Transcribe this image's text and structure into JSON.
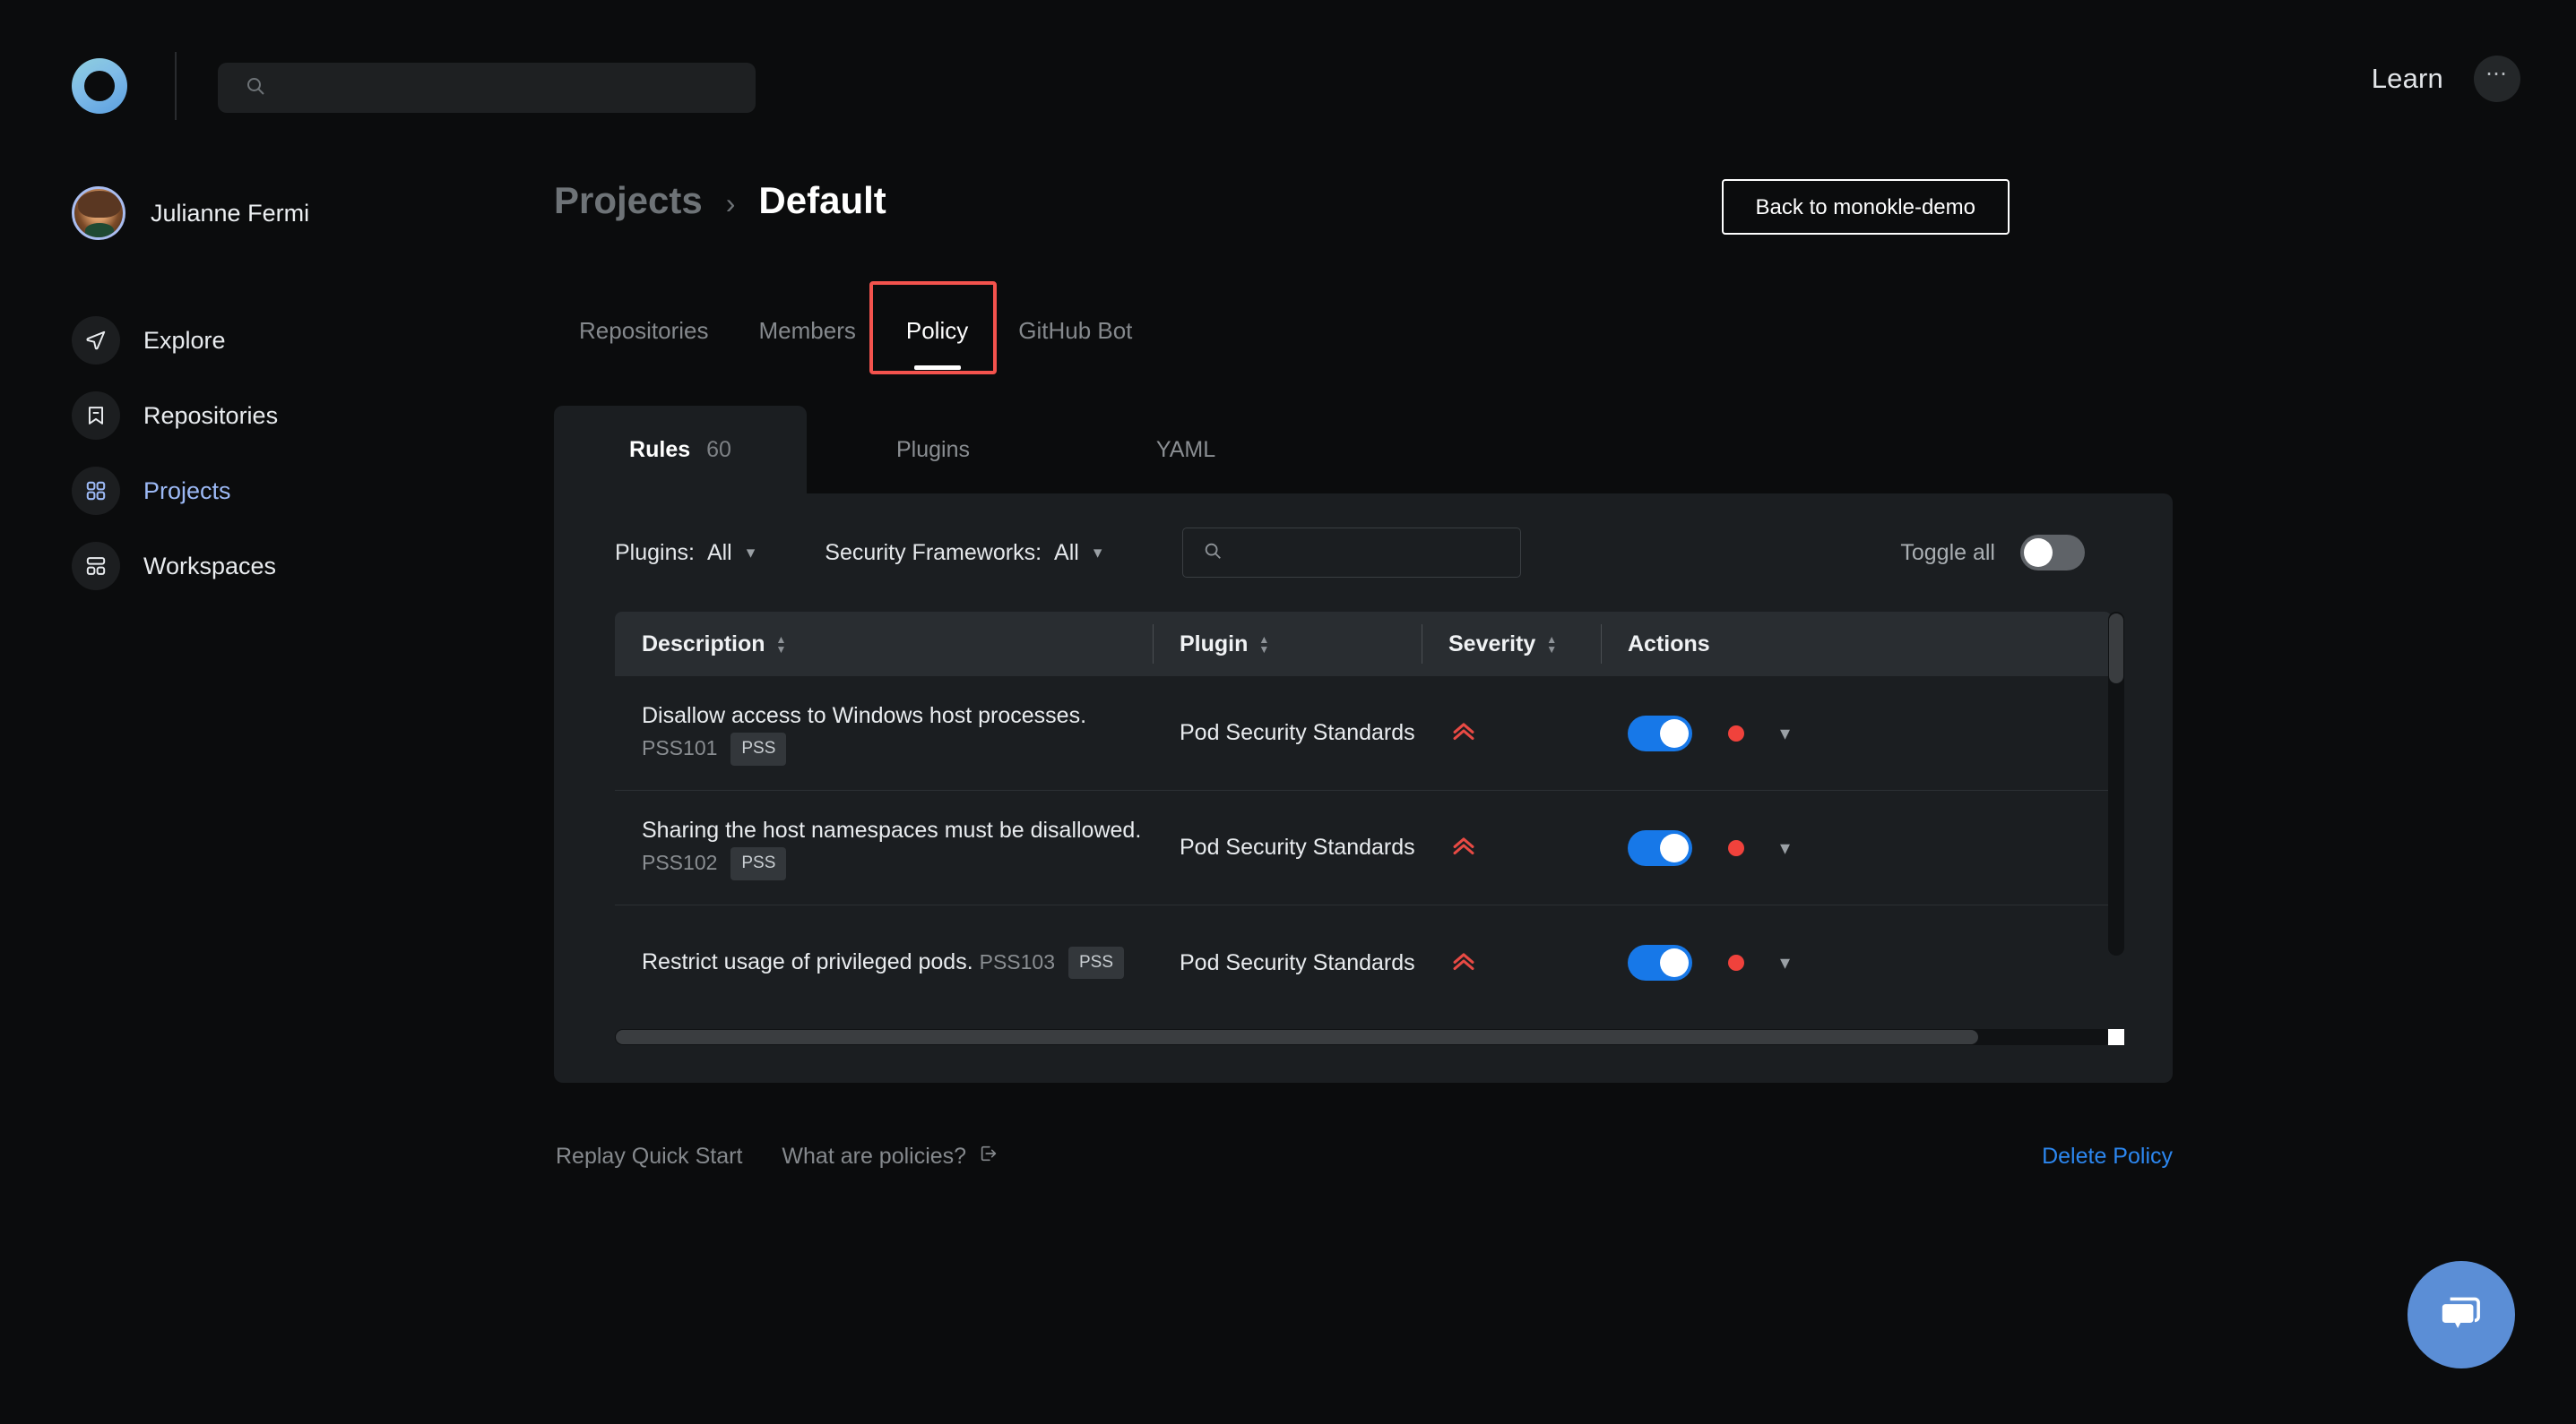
{
  "app": {
    "logo_icon": "monokle-ring-logo",
    "global_search_placeholder": "",
    "search_icon": "search-icon",
    "learn_label": "Learn",
    "more_icon": "ellipsis-icon"
  },
  "sidebar": {
    "user": {
      "name": "Julianne Fermi",
      "avatar_icon": "user-avatar"
    },
    "items": [
      {
        "label": "Explore",
        "icon": "paper-plane-icon",
        "active": false
      },
      {
        "label": "Repositories",
        "icon": "bookmark-minus-icon",
        "active": false
      },
      {
        "label": "Projects",
        "icon": "grid-four-squares-icon",
        "active": true
      },
      {
        "label": "Workspaces",
        "icon": "layout-panels-icon",
        "active": false
      }
    ]
  },
  "header": {
    "breadcrumb_root": "Projects",
    "breadcrumb_separator": "›",
    "breadcrumb_current": "Default",
    "back_button_label": "Back to monokle-demo"
  },
  "main_tabs": [
    {
      "label": "Repositories",
      "active": false
    },
    {
      "label": "Members",
      "active": false
    },
    {
      "label": "Policy",
      "active": true,
      "highlighted": true
    },
    {
      "label": "GitHub Bot",
      "active": false
    }
  ],
  "sub_tabs": [
    {
      "label": "Rules",
      "count": "60",
      "active": true
    },
    {
      "label": "Plugins",
      "count": "",
      "active": false
    },
    {
      "label": "YAML",
      "count": "",
      "active": false
    }
  ],
  "filters": {
    "plugins_label": "Plugins:",
    "plugins_value": "All",
    "frameworks_label": "Security Frameworks:",
    "frameworks_value": "All",
    "search_placeholder": "",
    "search_icon": "search-icon",
    "toggle_all_label": "Toggle all",
    "toggle_all_state": "off"
  },
  "table": {
    "columns": [
      {
        "key": "description",
        "label": "Description",
        "sortable": true
      },
      {
        "key": "plugin",
        "label": "Plugin",
        "sortable": true
      },
      {
        "key": "severity",
        "label": "Severity",
        "sortable": true
      },
      {
        "key": "actions",
        "label": "Actions",
        "sortable": false
      }
    ],
    "rows": [
      {
        "description": "Disallow access to Windows host processes.",
        "rule_id": "PSS101",
        "tag": "PSS",
        "plugin": "Pod Security Standards",
        "severity_icon": "double-chevron-up-icon",
        "severity_color": "#e84a44",
        "toggle_state": "on",
        "status_dot_color": "#f0423c",
        "expand_icon": "chevron-down-icon"
      },
      {
        "description": "Sharing the host namespaces must be disallowed.",
        "rule_id": "PSS102",
        "tag": "PSS",
        "plugin": "Pod Security Standards",
        "severity_icon": "double-chevron-up-icon",
        "severity_color": "#e84a44",
        "toggle_state": "on",
        "status_dot_color": "#f0423c",
        "expand_icon": "chevron-down-icon"
      },
      {
        "description": "Restrict usage of privileged pods.",
        "rule_id": "PSS103",
        "tag": "PSS",
        "plugin": "Pod Security Standards",
        "severity_icon": "double-chevron-up-icon",
        "severity_color": "#e84a44",
        "toggle_state": "on",
        "status_dot_color": "#f0423c",
        "expand_icon": "chevron-down-icon"
      }
    ]
  },
  "footer": {
    "replay_quick_start": "Replay Quick Start",
    "what_are_policies": "What are policies?",
    "external_link_icon": "external-link-icon",
    "delete_policy": "Delete Policy"
  },
  "chat": {
    "icon": "chat-bubble-icon"
  },
  "colors": {
    "accent_blue": "#1778e8",
    "link_blue": "#2c87f0",
    "danger_red": "#f0423c",
    "highlight_red": "#f4534d",
    "panel_bg": "#1b1e21",
    "page_bg": "#0b0c0d"
  }
}
